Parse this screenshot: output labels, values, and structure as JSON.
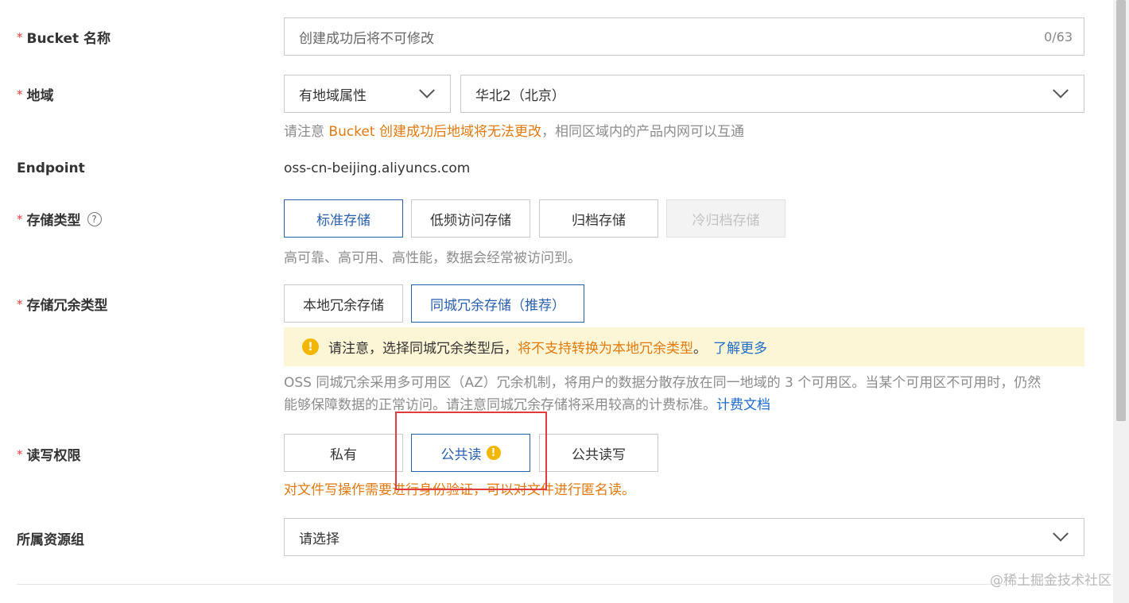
{
  "bucket_name": {
    "label": "Bucket 名称",
    "required_mark": "*",
    "placeholder": "创建成功后将不可修改",
    "counter": "0/63"
  },
  "region": {
    "label": "地域",
    "required_mark": "*",
    "type_value": "有地域属性",
    "region_value": "华北2（北京）",
    "hint_prefix": "请注意 ",
    "hint_warn": "Bucket 创建成功后地域将无法更改",
    "hint_suffix": "，相同区域内的产品内网可以互通"
  },
  "endpoint": {
    "label": "Endpoint",
    "value": "oss-cn-beijing.aliyuncs.com"
  },
  "storage_class": {
    "label": "存储类型",
    "required_mark": "*",
    "help_icon": "?",
    "options": [
      "标准存储",
      "低频访问存储",
      "归档存储",
      "冷归档存储"
    ],
    "selected": "标准存储",
    "disabled": "冷归档存储",
    "hint": "高可靠、高可用、高性能，数据会经常被访问到。"
  },
  "redundancy": {
    "label": "存储冗余类型",
    "required_mark": "*",
    "options": [
      "本地冗余存储",
      "同城冗余存储（推荐）"
    ],
    "selected": "同城冗余存储（推荐）",
    "notice_icon": "!",
    "notice_prefix": "请注意，选择同城冗余类型后，",
    "notice_warn": "将不支持转换为本地冗余类型",
    "notice_suffix": "。",
    "notice_link": "了解更多",
    "desc_line1": "OSS 同城冗余采用多可用区（AZ）冗余机制，将用户的数据分散存放在同一地域的 3 个可用区。当某个可用区不可用时，仍然",
    "desc_line2": "能够保障数据的正常访问。请注意同城冗余存储将采用较高的计费标准。",
    "desc_link": "计费文档"
  },
  "acl": {
    "label": "读写权限",
    "required_mark": "*",
    "options": [
      "私有",
      "公共读",
      "公共读写"
    ],
    "selected": "公共读",
    "warn_icon": "!",
    "warning": "对文件写操作需要进行身份验证，可以对文件进行匿名读。"
  },
  "resource_group": {
    "label": "所属资源组",
    "placeholder": "请选择"
  },
  "watermark": "@稀土掘金技术社区",
  "colors": {
    "accent": "#2a5fae",
    "link": "#1e6bc9",
    "warning": "#e07a0f",
    "required": "#e43b3b",
    "notice_bg": "#fdf6d6",
    "highlight_box": "#e23b3b"
  }
}
